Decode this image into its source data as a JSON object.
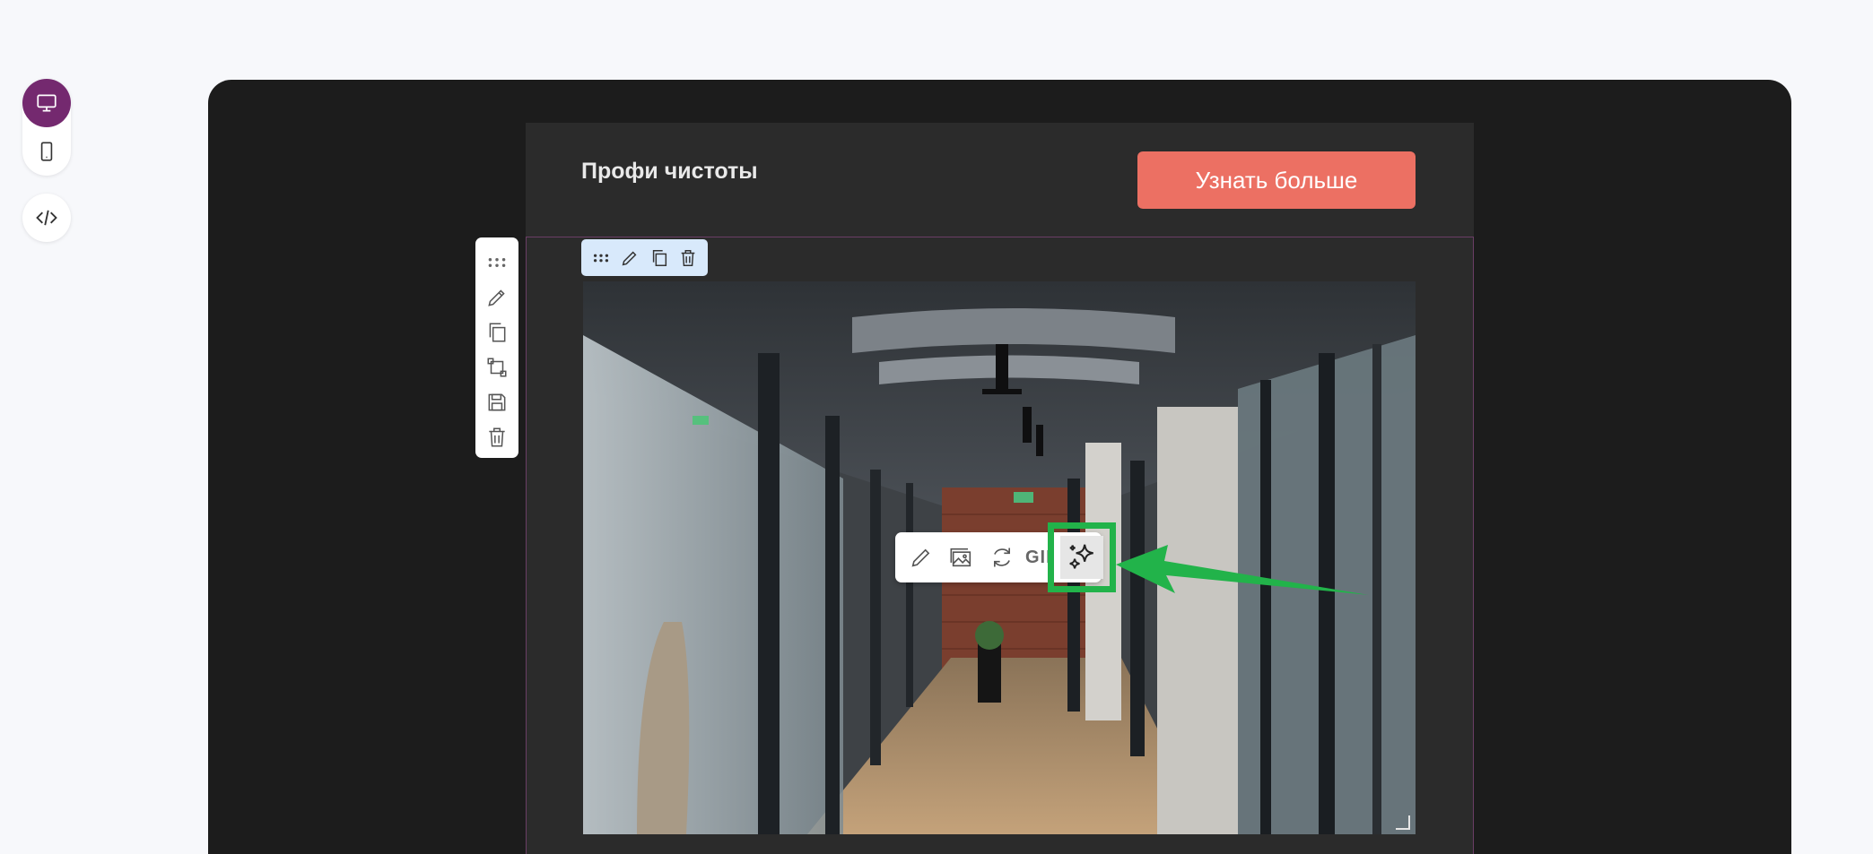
{
  "header": {
    "brand": "Профи чистоты",
    "cta_label": "Узнать больше"
  },
  "view_switch": {
    "items": [
      "desktop-view",
      "mobile-view"
    ],
    "active": "desktop-view",
    "code": "code-view"
  },
  "image_toolbar": {
    "gif_label": "GIF"
  },
  "colors": {
    "accent": "#74296f",
    "cta": "#ec7063",
    "highlight": "#22b34a",
    "canvas": "#1c1c1c",
    "email_bg": "#2b2b2b"
  }
}
